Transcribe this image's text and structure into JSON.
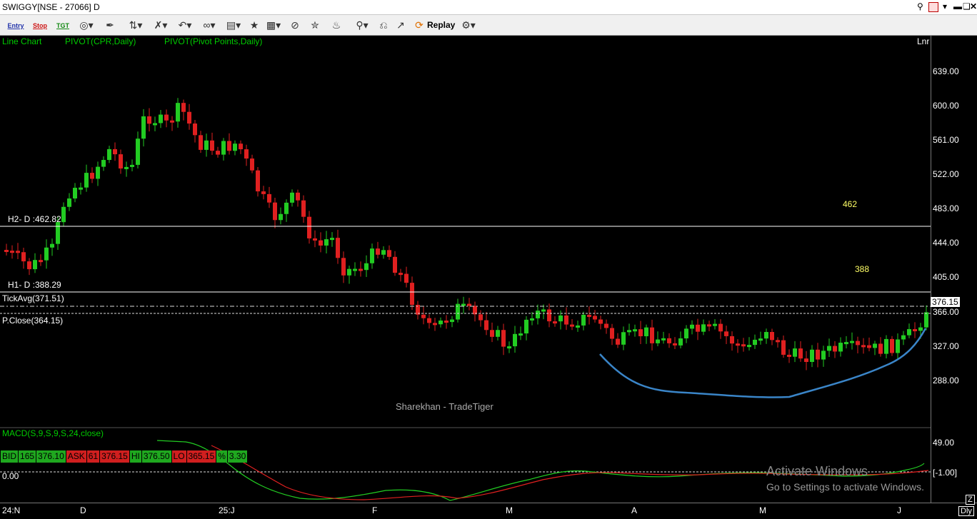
{
  "window": {
    "title": "SWIGGY[NSE - 27066] D"
  },
  "toolbar": {
    "entry": "Entry",
    "stop": "Stop",
    "tgt": "TGT",
    "replay": "Replay"
  },
  "chart": {
    "indicators": [
      "Line Chart",
      "PIVOT(CPR,Daily)",
      "PIVOT(Pivot Points,Daily)"
    ],
    "scale_mode": "Lnr",
    "h2_label": "H2- D :462.82",
    "h1_label": "H1- D :388.29",
    "tickavg_label": "TickAvg(371.51)",
    "pclose_label": "P.Close(364.15)",
    "annot_462": "462",
    "annot_388": "388",
    "watermark": "Sharekhan - TradeTiger",
    "price_ticks": [
      "639.00",
      "600.00",
      "561.00",
      "522.00",
      "483.00",
      "444.00",
      "405.00",
      "366.00",
      "327.00",
      "288.00"
    ],
    "last_price": "376.15",
    "bid": {
      "label": "BID",
      "qty": "165",
      "price": "376.10"
    },
    "ask": {
      "label": "ASK",
      "qty": "61",
      "price": "376.15"
    },
    "hi": {
      "label": "HI",
      "value": "376.50"
    },
    "lo": {
      "label": "LO",
      "value": "365.15"
    },
    "pct": {
      "label": "%",
      "value": "3.30"
    },
    "macd": {
      "label": "MACD(S,9,S,9,S,24,close)",
      "ticks": [
        "49.00",
        "[-1.00]"
      ],
      "zero_label": "0.00"
    },
    "x_labels": [
      "24:N",
      "D",
      "25:J",
      "F",
      "M",
      "A",
      "M",
      "J"
    ],
    "corner": {
      "z": "Z",
      "period": "Dly"
    },
    "colors": {
      "up": "#22cc22",
      "down": "#e02020",
      "indicator": "#00cc00",
      "annotation": "#ffff66",
      "curve": "#3a85c8"
    }
  },
  "overlay": {
    "activate_title": "Activate Windows",
    "activate_sub": "Go to Settings to activate Windows."
  }
}
